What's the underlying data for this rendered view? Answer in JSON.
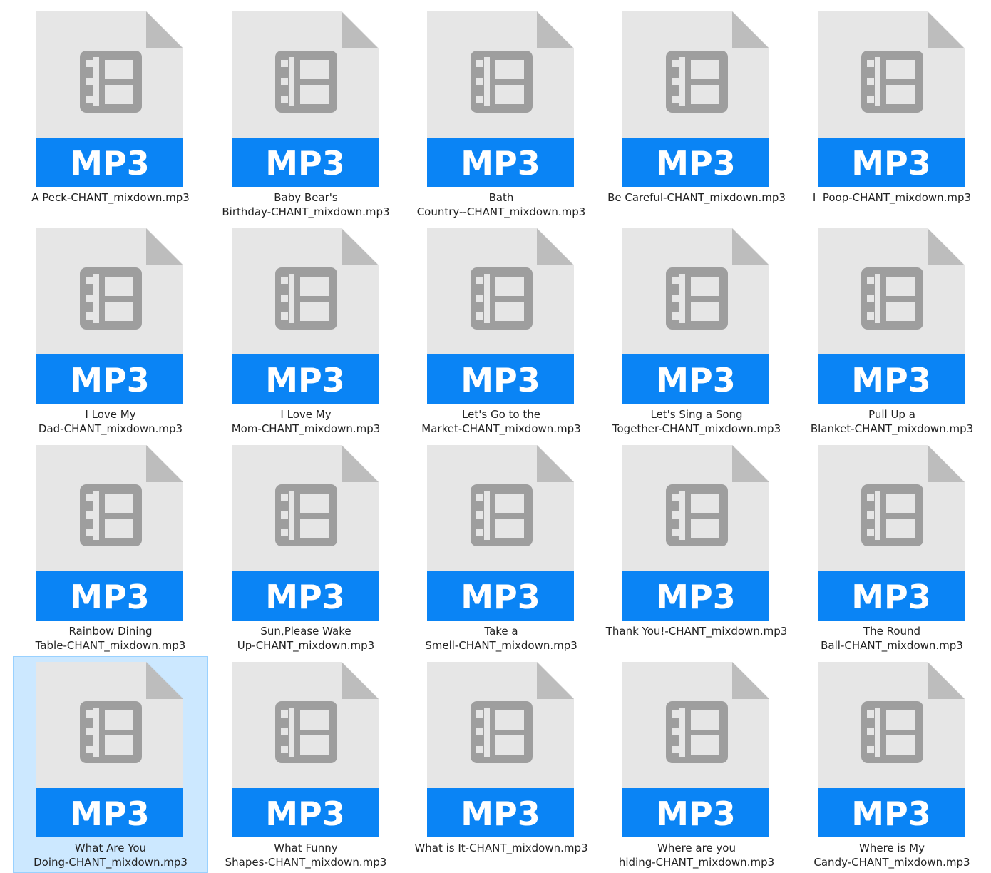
{
  "colors": {
    "page_bg": "#ffffff",
    "doc_body": "#e6e6e6",
    "doc_fold": "#bdbdbd",
    "doc_glyph": "#9e9e9e",
    "band": "#0a84f5",
    "band_text": "#ffffff",
    "selection_bg": "#cce8ff",
    "selection_border": "#99d1ff",
    "label_text": "#222222"
  },
  "file_icon": {
    "name": "mp3-file-icon",
    "glyph": "film-strip-icon",
    "type_label": "MP3"
  },
  "files": [
    {
      "lines": [
        "A Peck-CHANT_mixdown.mp3"
      ],
      "selected": false
    },
    {
      "lines": [
        "Baby Bear's",
        "Birthday-CHANT_mixdown.mp3"
      ],
      "selected": false
    },
    {
      "lines": [
        "Bath",
        "Country--CHANT_mixdown.mp3"
      ],
      "selected": false
    },
    {
      "lines": [
        "Be Careful-CHANT_mixdown.mp3"
      ],
      "selected": false
    },
    {
      "lines": [
        "I  Poop-CHANT_mixdown.mp3"
      ],
      "selected": false
    },
    {
      "lines": [
        "I Love My",
        "Dad-CHANT_mixdown.mp3"
      ],
      "selected": false
    },
    {
      "lines": [
        "I Love My",
        "Mom-CHANT_mixdown.mp3"
      ],
      "selected": false
    },
    {
      "lines": [
        "Let's Go to the",
        "Market-CHANT_mixdown.mp3"
      ],
      "selected": false
    },
    {
      "lines": [
        "Let's Sing a Song",
        "Together-CHANT_mixdown.mp3"
      ],
      "selected": false
    },
    {
      "lines": [
        "Pull Up a",
        "Blanket-CHANT_mixdown.mp3"
      ],
      "selected": false
    },
    {
      "lines": [
        "Rainbow Dining",
        "Table-CHANT_mixdown.mp3"
      ],
      "selected": false
    },
    {
      "lines": [
        "Sun,Please Wake",
        "Up-CHANT_mixdown.mp3"
      ],
      "selected": false
    },
    {
      "lines": [
        "Take a",
        "Smell-CHANT_mixdown.mp3"
      ],
      "selected": false
    },
    {
      "lines": [
        "Thank You!-CHANT_mixdown.mp3"
      ],
      "selected": false
    },
    {
      "lines": [
        "The Round",
        "Ball-CHANT_mixdown.mp3"
      ],
      "selected": false
    },
    {
      "lines": [
        "What Are You",
        "Doing-CHANT_mixdown.mp3"
      ],
      "selected": true
    },
    {
      "lines": [
        "What Funny",
        "Shapes-CHANT_mixdown.mp3"
      ],
      "selected": false
    },
    {
      "lines": [
        "What is It-CHANT_mixdown.mp3"
      ],
      "selected": false
    },
    {
      "lines": [
        "Where are you",
        "hiding-CHANT_mixdown.mp3"
      ],
      "selected": false
    },
    {
      "lines": [
        "Where is My",
        "Candy-CHANT_mixdown.mp3"
      ],
      "selected": false
    }
  ]
}
